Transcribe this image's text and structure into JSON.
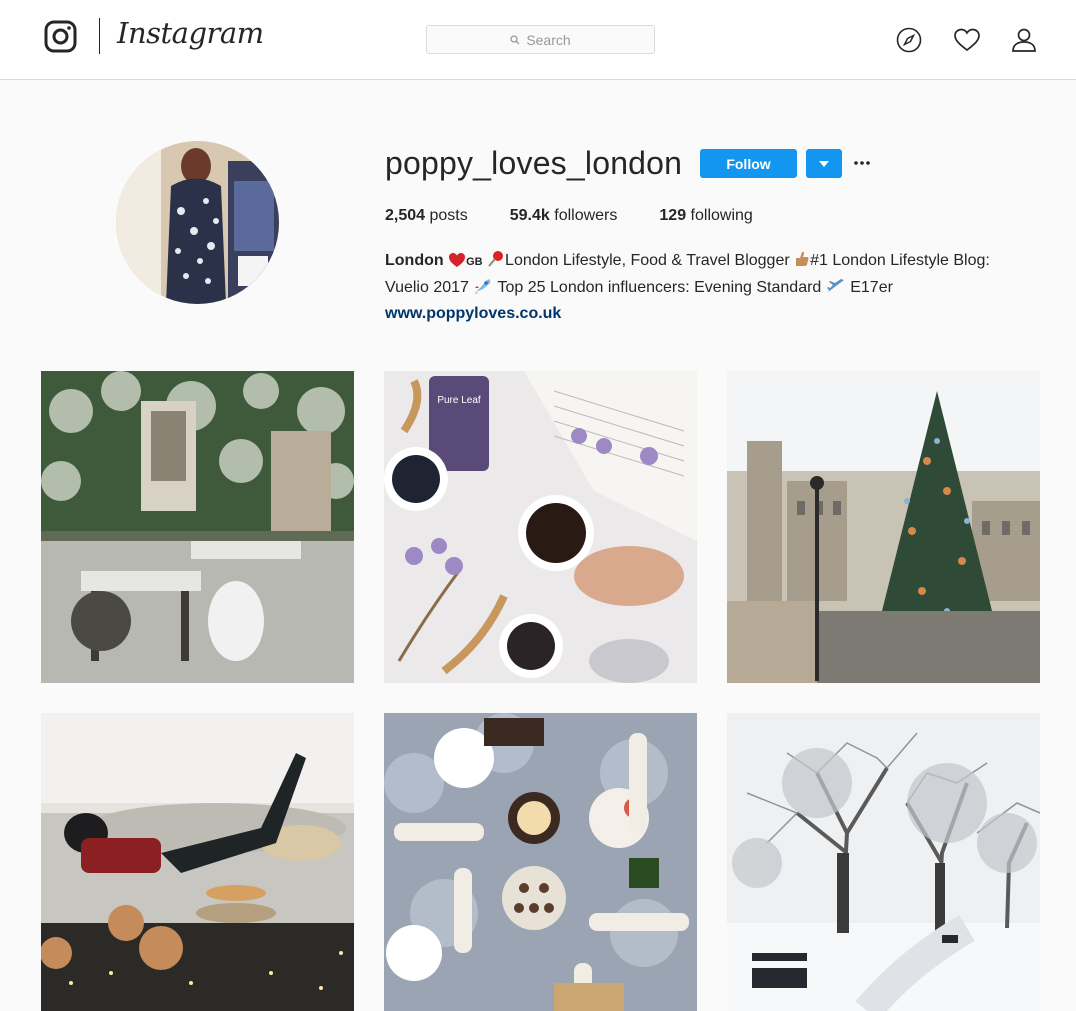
{
  "header": {
    "wordmark": "Instagram",
    "search_placeholder": "Search"
  },
  "profile": {
    "username": "poppy_loves_london",
    "follow_label": "Follow",
    "stats": [
      {
        "count": "2,504",
        "label": "posts"
      },
      {
        "count": "59.4k",
        "label": "followers"
      },
      {
        "count": "129",
        "label": "following"
      }
    ],
    "bio": {
      "name": "London",
      "flag_text": "GB",
      "line1": "London Lifestyle, Food & Travel Blogger",
      "line1b": "#1 London Lifestyle Blog:",
      "line2a": "Vuelio 2017",
      "line2b": "Top 25 London influencers: Evening Standard",
      "line2c": "E17er",
      "website": "www.poppyloves.co.uk"
    }
  },
  "brand": {
    "wordmark_label": "Pure Leaf",
    "accent": "#1296f0",
    "link": "#003569"
  }
}
